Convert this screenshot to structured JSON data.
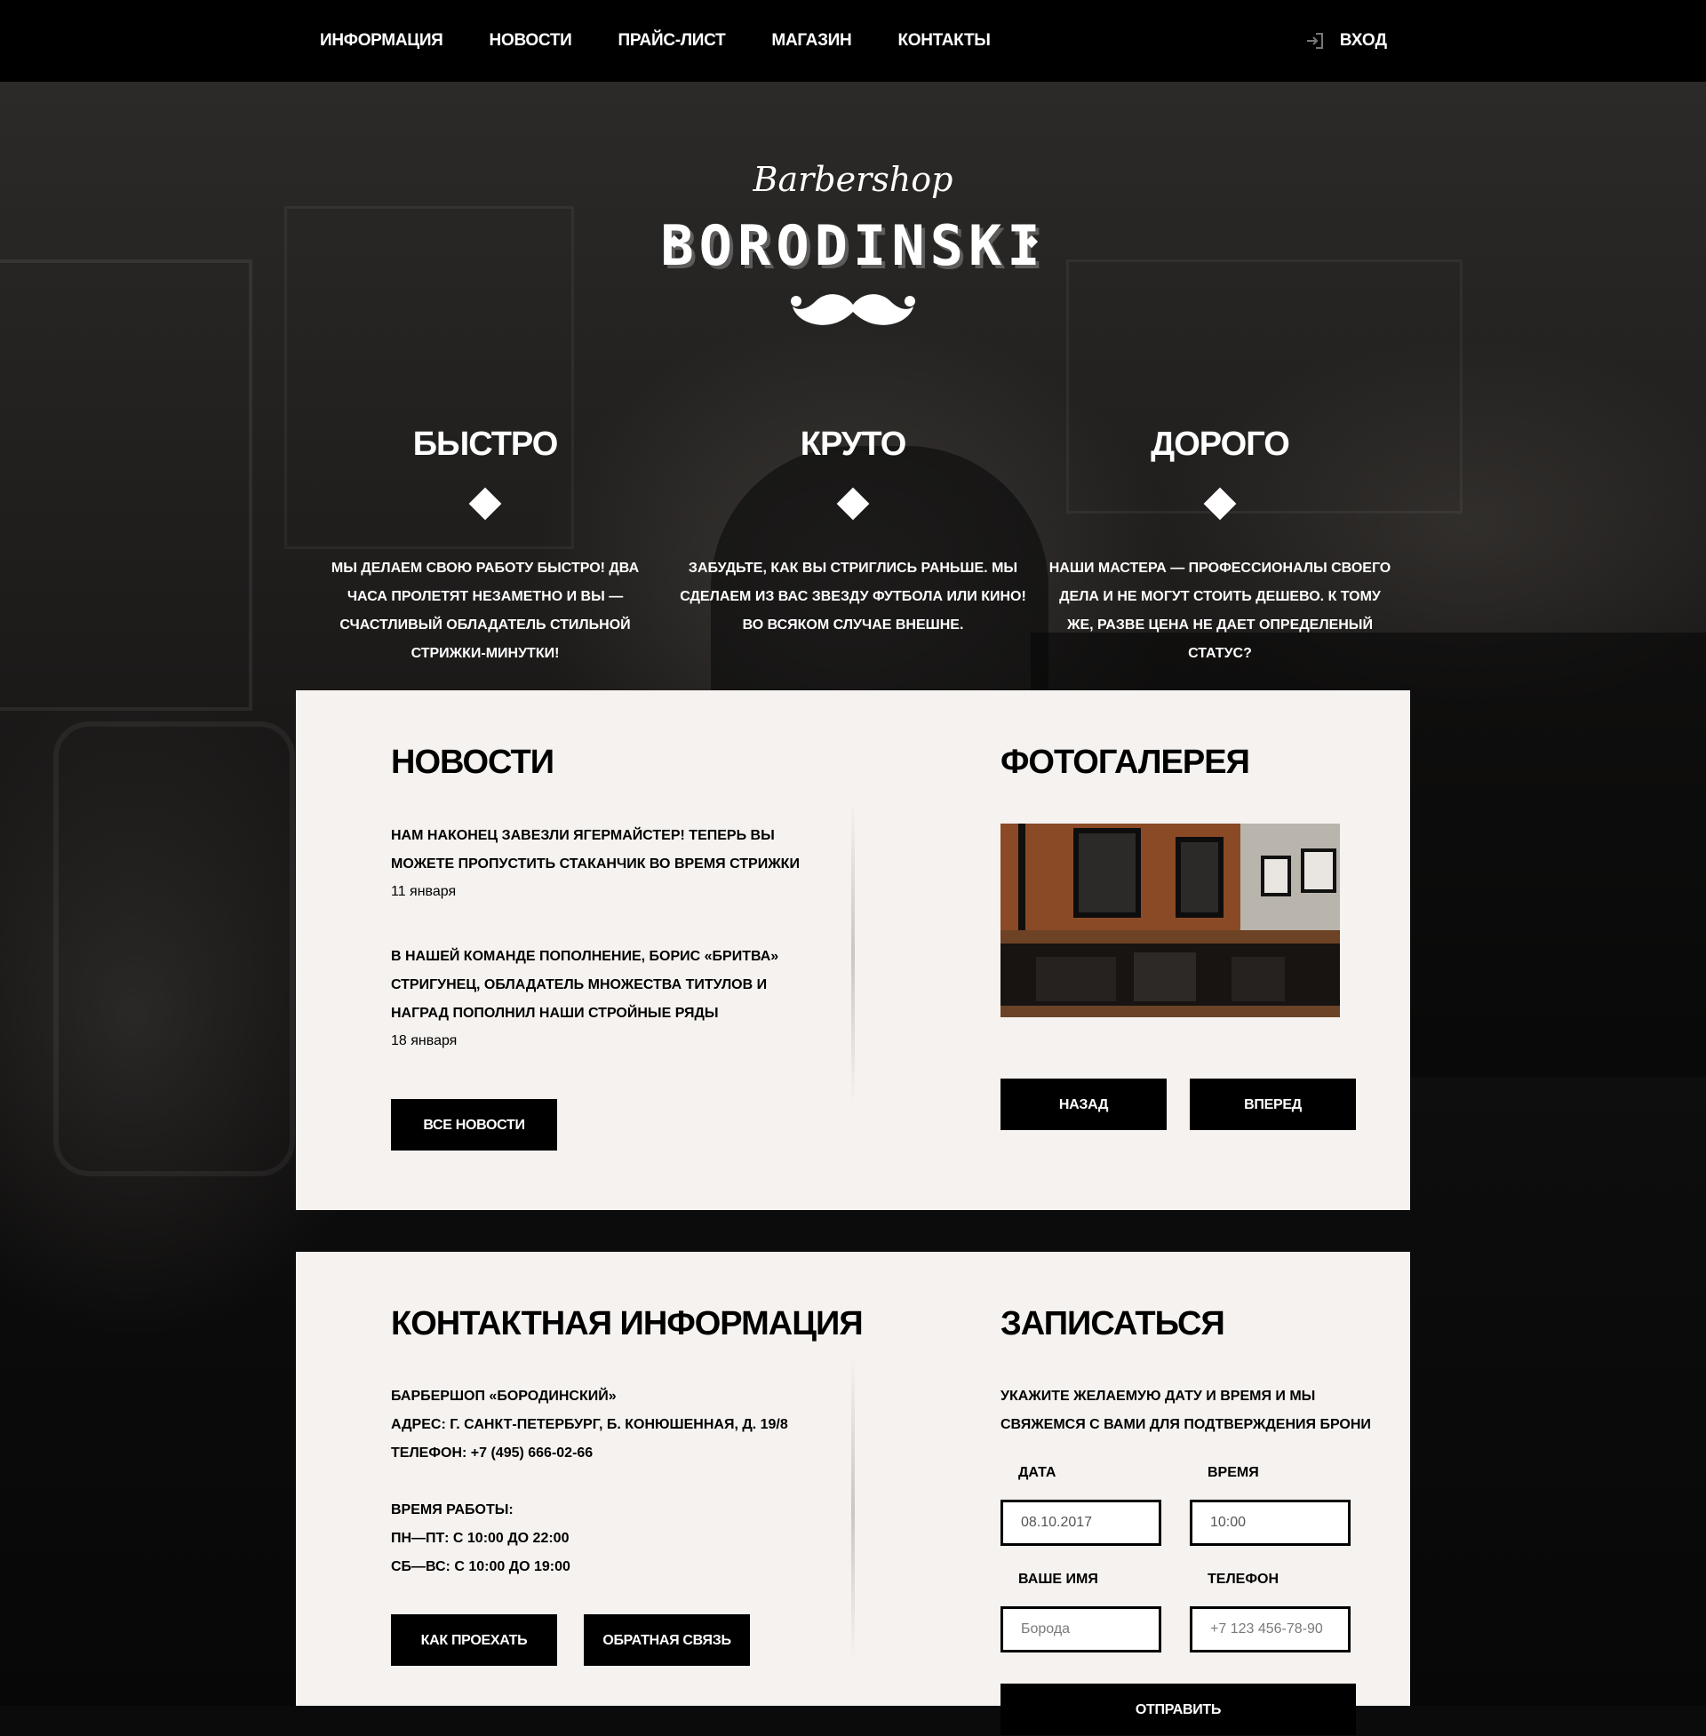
{
  "nav": {
    "items": [
      "ИНФОРМАЦИЯ",
      "НОВОСТИ",
      "ПРАЙС-ЛИСТ",
      "МАГАЗИН",
      "КОНТАКТЫ"
    ],
    "login_label": "ВХОД"
  },
  "logo": {
    "script": "Barbershop",
    "name": "BORODINSKI"
  },
  "features": [
    {
      "title": "БЫСТРО",
      "text": "МЫ ДЕЛАЕМ СВОЮ РАБОТУ БЫСТРО! ДВА ЧАСА ПРОЛЕТЯТ НЕЗАМЕТНО И ВЫ — СЧАСТЛИВЫЙ ОБЛАДАТЕЛЬ СТИЛЬНОЙ СТРИЖКИ-МИНУТКИ!"
    },
    {
      "title": "КРУТО",
      "text": "ЗАБУДЬТЕ, КАК ВЫ СТРИГЛИСЬ РАНЬШЕ. МЫ СДЕЛАЕМ ИЗ ВАС ЗВЕЗДУ ФУТБОЛА ИЛИ КИНО! ВО ВСЯКОМ СЛУЧАЕ ВНЕШНЕ."
    },
    {
      "title": "ДОРОГО",
      "text": "НАШИ МАСТЕРА — ПРОФЕССИОНАЛЫ СВОЕГО ДЕЛА И НЕ МОГУТ СТОИТЬ ДЕШЕВО. К ТОМУ ЖЕ, РАЗВЕ ЦЕНА НЕ ДАЕТ ОПРЕДЕЛЕНЫЙ СТАТУС?"
    }
  ],
  "news": {
    "title": "НОВОСТИ",
    "items": [
      {
        "text": "НАМ НАКОНЕЦ ЗАВЕЗЛИ ЯГЕРМАЙСТЕР! ТЕПЕРЬ ВЫ МОЖЕТЕ ПРОПУСТИТЬ СТАКАНЧИК ВО ВРЕМЯ СТРИЖКИ",
        "date": "11 января"
      },
      {
        "text": "В НАШЕЙ КОМАНДЕ ПОПОЛНЕНИЕ, БОРИС «БРИТВА» СТРИГУНЕЦ, ОБЛАДАТЕЛЬ МНОЖЕСТВА ТИТУЛОВ И НАГРАД ПОПОЛНИЛ НАШИ СТРОЙНЫЕ РЯДЫ",
        "date": "18 января"
      }
    ],
    "all_button": "ВСЕ НОВОСТИ"
  },
  "gallery": {
    "title": "ФОТОГАЛЕРЕЯ",
    "prev_button": "НАЗАД",
    "next_button": "ВПЕРЕД"
  },
  "contacts": {
    "title": "КОНТАКТНАЯ ИНФОРМАЦИЯ",
    "lines": [
      "БАРБЕРШОП «БОРОДИНСКИЙ»",
      "АДРЕС: Г. САНКТ-ПЕТЕРБУРГ, Б. КОНЮШЕННАЯ, Д. 19/8",
      "ТЕЛЕФОН: +7 (495) 666-02-66"
    ],
    "hours": [
      "ВРЕМЯ РАБОТЫ:",
      "ПН—ПТ: С 10:00 ДО 22:00",
      "СБ—ВС: С 10:00 ДО 19:00"
    ],
    "route_button": "КАК ПРОЕХАТЬ",
    "feedback_button": "ОБРАТНАЯ СВЯЗЬ"
  },
  "booking": {
    "title": "ЗАПИСАТЬСЯ",
    "text": "УКАЖИТЕ ЖЕЛАЕМУЮ ДАТУ И ВРЕМЯ И МЫ СВЯЖЕМСЯ С ВАМИ ДЛЯ ПОДТВЕРЖДЕНИЯ БРОНИ",
    "date_label": "ДАТА",
    "date_value": "08.10.2017",
    "time_label": "ВРЕМЯ",
    "time_value": "10:00",
    "name_label": "ВАШЕ ИМЯ",
    "name_placeholder": "Борода",
    "phone_label": "ТЕЛЕФОН",
    "phone_placeholder": "+7 123 456-78-90",
    "submit_button": "ОТПРАВИТЬ"
  }
}
